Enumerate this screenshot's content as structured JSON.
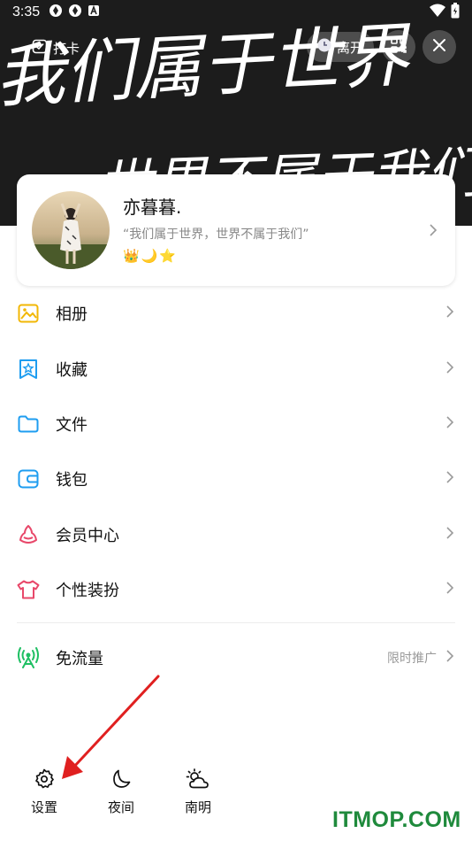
{
  "status_bar": {
    "time": "3:35"
  },
  "cover_text": {
    "line1": "我们属于世界",
    "line2": "世界不属于我们"
  },
  "header": {
    "punch_label": "打卡",
    "leave_label": "离开"
  },
  "profile": {
    "name": "亦暮暮.",
    "signature": "“我们属于世界，世界不属于我们”",
    "badges": [
      "👑",
      "🌙",
      "⭐"
    ]
  },
  "menu": {
    "items": [
      {
        "label": "相册",
        "icon": "album-icon",
        "color": "#f2b705"
      },
      {
        "label": "收藏",
        "icon": "favorite-icon",
        "color": "#1e9df0"
      },
      {
        "label": "文件",
        "icon": "folder-icon",
        "color": "#1e9df0"
      },
      {
        "label": "钱包",
        "icon": "wallet-icon",
        "color": "#1e9df0"
      },
      {
        "label": "会员中心",
        "icon": "vip-icon",
        "color": "#e8486a"
      },
      {
        "label": "个性装扮",
        "icon": "tshirt-icon",
        "color": "#e8486a"
      }
    ],
    "traffic": {
      "label": "免流量",
      "extra": "限时推广",
      "icon": "signal-icon",
      "color": "#1fbf63"
    }
  },
  "bottom": {
    "settings_label": "设置",
    "night_label": "夜间",
    "weather_label": "南明"
  },
  "watermark": "ITMOP.COM",
  "colors": {
    "arrow": "#e02020",
    "watermark": "#1f8a3c"
  }
}
